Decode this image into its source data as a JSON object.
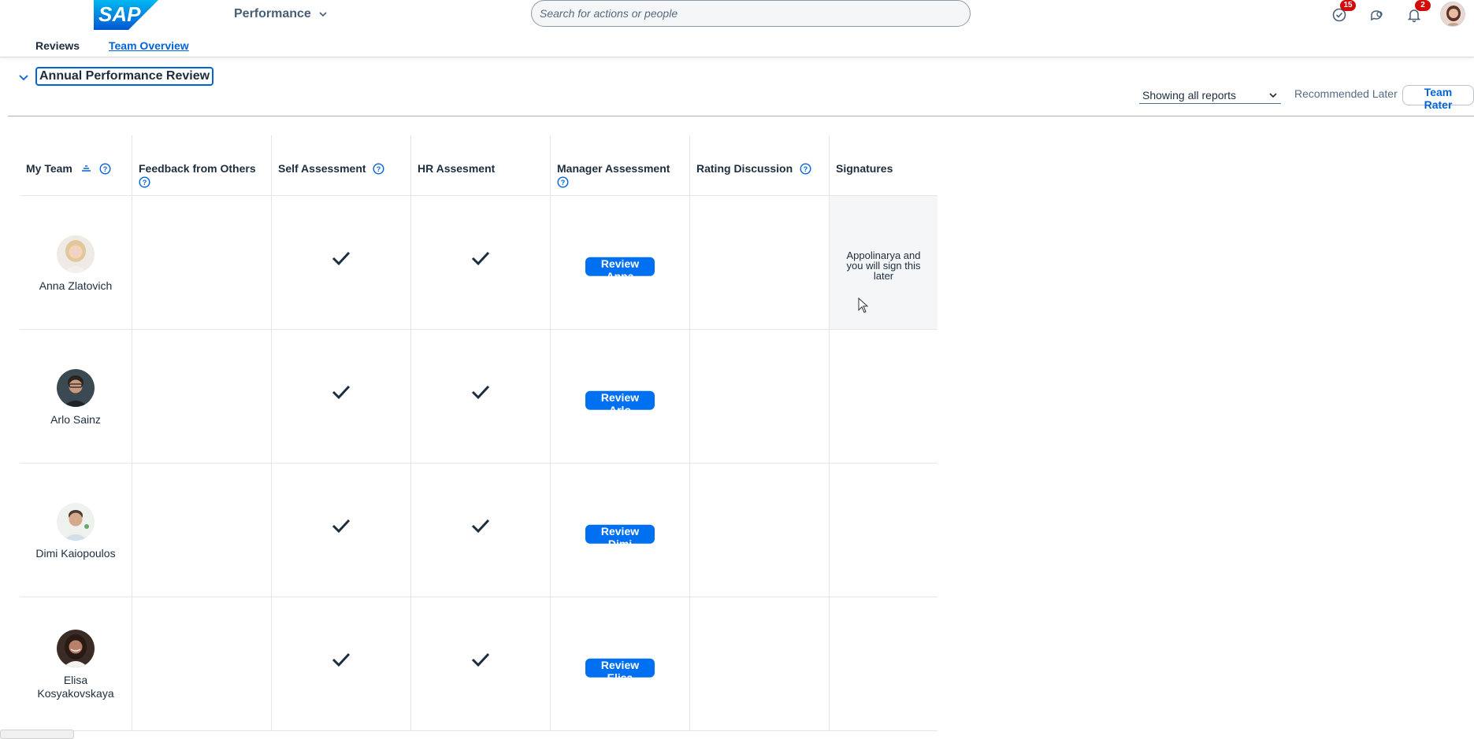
{
  "shell": {
    "logo_text": "SAP",
    "app_title": "Performance",
    "search_placeholder": "Search for actions or people",
    "tasks_badge": "15",
    "notifications_badge": "2"
  },
  "tabs": {
    "reviews": "Reviews",
    "team_overview": "Team Overview"
  },
  "section": {
    "title": "Annual Performance Review",
    "filter_value": "Showing all reports",
    "recommended_later": "Recommended Later",
    "team_rater": "Team Rater"
  },
  "columns": {
    "my_team": "My Team",
    "feedback": "Feedback from Others",
    "self": "Self Assessment",
    "hr": "HR Assesment",
    "manager": "Manager Assessment",
    "rating": "Rating Discussion",
    "signatures": "Signatures"
  },
  "rows": [
    {
      "name": "Anna Zlatovich",
      "review_button": "Review Anna",
      "signature_note": "Appolinarya and you will sign this later"
    },
    {
      "name": "Arlo Sainz",
      "review_button": "Review Arlo",
      "signature_note": ""
    },
    {
      "name": "Dimi Kaiopoulos",
      "review_button": "Review Dimi",
      "signature_note": ""
    },
    {
      "name": "Elisa Kosyakovskaya",
      "review_button": "Review Elisa",
      "signature_note": ""
    }
  ],
  "colors": {
    "accent": "#0064d9",
    "button": "#0070f2",
    "badge": "#d20a0a"
  }
}
